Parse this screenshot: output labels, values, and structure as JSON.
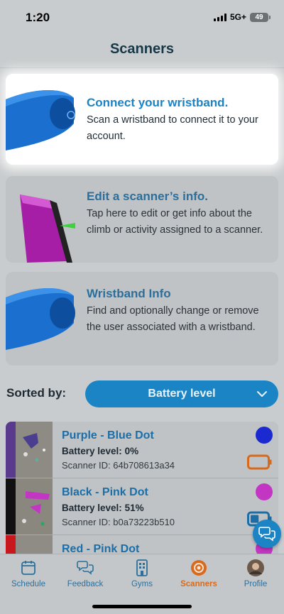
{
  "status_bar": {
    "time": "1:20",
    "network": "5G+",
    "battery": "49"
  },
  "header": {
    "title": "Scanners"
  },
  "cards": [
    {
      "title": "Connect your wristband.",
      "description": "Scan a wristband to connect it to your account.",
      "art": "blue-wristband-icon"
    },
    {
      "title": "Edit a scanner’s info.",
      "description": "Tap here to edit or get info about the climb or activity assigned to a scanner.",
      "art": "purple-scanner-icon"
    },
    {
      "title": "Wristband Info",
      "description": "Find and optionally change or remove the user associated with a wristband.",
      "art": "blue-wristband-icon"
    }
  ],
  "sort": {
    "label": "Sorted by:",
    "selected": "Battery level"
  },
  "scanners": [
    {
      "name": "Purple - Blue Dot",
      "battery_label": "Battery level:",
      "battery_value": "0%",
      "battery_fraction": 0.0,
      "id_label": "Scanner ID:",
      "id": "64b708613a34",
      "stripe_color": "#5a3a8c",
      "dot_color": "#1a2ad0",
      "battery_color": "#d66a1c"
    },
    {
      "name": "Black - Pink Dot",
      "battery_label": "Battery level:",
      "battery_value": "51%",
      "battery_fraction": 0.51,
      "id_label": "Scanner ID:",
      "id": "b0a73223b510",
      "stripe_color": "#111111",
      "dot_color": "#c336c3",
      "battery_color": "#1b6ea6"
    },
    {
      "name": "Red - Pink Dot",
      "battery_label": "",
      "battery_value": "",
      "battery_fraction": null,
      "id_label": "",
      "id": "",
      "stripe_color": "#c8181e",
      "dot_color": "#c336c3",
      "battery_color": "#1b6ea6"
    }
  ],
  "tabs": [
    {
      "label": "Schedule",
      "icon": "calendar-icon",
      "active": false
    },
    {
      "label": "Feedback",
      "icon": "chat-bubbles-icon",
      "active": false
    },
    {
      "label": "Gyms",
      "icon": "building-icon",
      "active": false
    },
    {
      "label": "Scanners",
      "icon": "scanner-target-icon",
      "active": true
    },
    {
      "label": "Profile",
      "icon": "avatar-icon",
      "active": false
    }
  ],
  "colors": {
    "accent": "#1b84c4",
    "active_tab": "#d86a1d",
    "title": "#173847"
  }
}
